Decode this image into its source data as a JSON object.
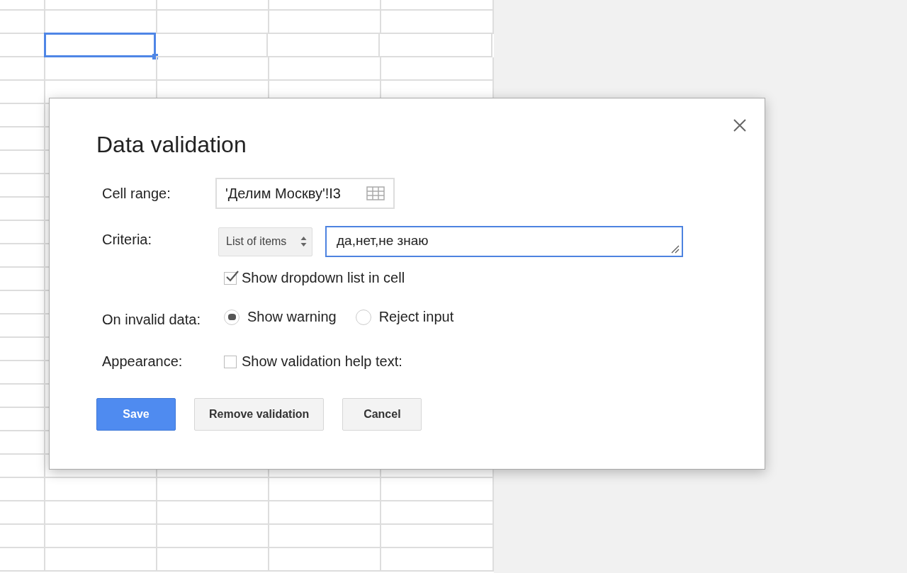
{
  "dialog": {
    "title": "Data validation",
    "cell_range": {
      "label": "Cell range:",
      "value": "'Делим Москву'!I3"
    },
    "criteria": {
      "label": "Criteria:",
      "type": "List of items",
      "value": "да,нет,не знаю"
    },
    "dropdown_option": {
      "label": "Show dropdown list in cell",
      "checked": true
    },
    "on_invalid": {
      "label": "On invalid data:",
      "options": [
        {
          "label": "Show warning",
          "selected": true
        },
        {
          "label": "Reject input",
          "selected": false
        }
      ]
    },
    "appearance": {
      "label": "Appearance:",
      "option": {
        "label": "Show validation help text:",
        "checked": false
      }
    },
    "buttons": [
      {
        "label": "Save",
        "kind": "primary"
      },
      {
        "label": "Remove validation",
        "kind": "default"
      },
      {
        "label": "Cancel",
        "kind": "default"
      }
    ]
  }
}
